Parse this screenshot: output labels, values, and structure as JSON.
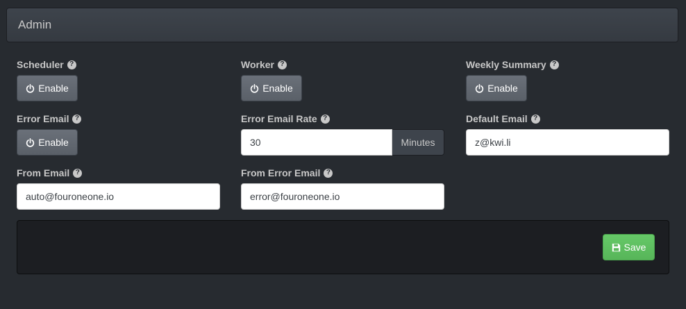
{
  "header": {
    "title": "Admin"
  },
  "fields": {
    "scheduler": {
      "label": "Scheduler",
      "button": "Enable"
    },
    "worker": {
      "label": "Worker",
      "button": "Enable"
    },
    "weekly_summary": {
      "label": "Weekly Summary",
      "button": "Enable"
    },
    "error_email": {
      "label": "Error Email",
      "button": "Enable"
    },
    "error_email_rate": {
      "label": "Error Email Rate",
      "value": "30",
      "addon": "Minutes"
    },
    "default_email": {
      "label": "Default Email",
      "value": "z@kwi.li"
    },
    "from_email": {
      "label": "From Email",
      "value": "auto@fouroneone.io"
    },
    "from_error_email": {
      "label": "From Error Email",
      "value": "error@fouroneone.io"
    }
  },
  "help_icon_glyph": "?",
  "footer": {
    "save_label": "Save"
  },
  "icons": {
    "enable": "power-icon",
    "help": "question-circle-icon",
    "save": "floppy-disk-icon"
  },
  "colors": {
    "background": "#272b30",
    "save_button": "#5cb85c",
    "enable_button": "#62686f"
  }
}
